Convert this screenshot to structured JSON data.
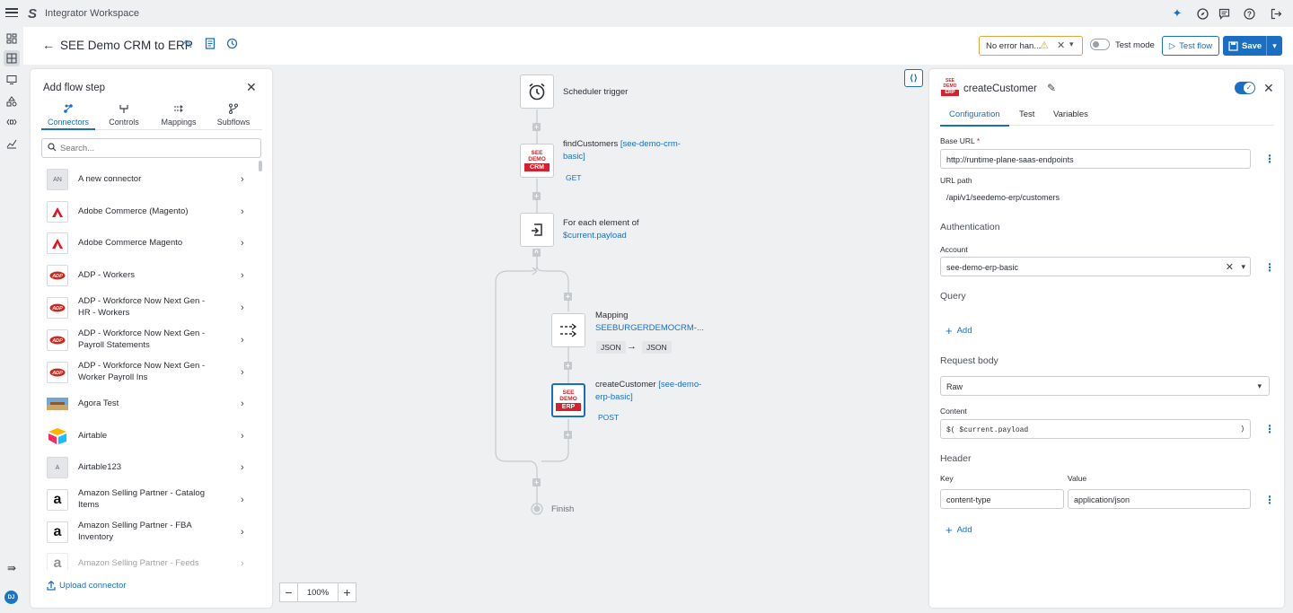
{
  "app": {
    "title": "Integrator Workspace"
  },
  "topbar_icons": [
    "sparkle-icon",
    "compass-icon",
    "chat-icon",
    "help-icon",
    "logout-icon"
  ],
  "rail": {
    "avatar_initials": "DJ"
  },
  "header": {
    "flow_title": "SEE Demo CRM to ERP",
    "error_handling": "No error han...",
    "test_mode_label": "Test mode",
    "test_flow_label": "Test flow",
    "save_label": "Save"
  },
  "add_step": {
    "title": "Add flow step",
    "tabs": [
      {
        "label": "Connectors",
        "icon": "connectors-icon"
      },
      {
        "label": "Controls",
        "icon": "controls-icon"
      },
      {
        "label": "Mappings",
        "icon": "mappings-icon"
      },
      {
        "label": "Subflows",
        "icon": "subflows-icon"
      }
    ],
    "search_placeholder": "Search...",
    "items": [
      {
        "label": "A new connector",
        "logo": "AN"
      },
      {
        "label": "Adobe Commerce (Magento)",
        "logo": "adobe"
      },
      {
        "label": "Adobe Commerce Magento",
        "logo": "adobe"
      },
      {
        "label": "ADP - Workers",
        "logo": "adp"
      },
      {
        "label": "ADP - Workforce Now Next Gen - HR - Workers",
        "logo": "adp"
      },
      {
        "label": "ADP - Workforce Now Next Gen - Payroll Statements",
        "logo": "adp"
      },
      {
        "label": "ADP - Workforce Now Next Gen - Worker Payroll Ins",
        "logo": "adp"
      },
      {
        "label": "Agora Test",
        "logo": "agora"
      },
      {
        "label": "Airtable",
        "logo": "airtable"
      },
      {
        "label": "Airtable123",
        "logo": "A"
      },
      {
        "label": "Amazon Selling Partner - Catalog Items",
        "logo": "a"
      },
      {
        "label": "Amazon Selling Partner - FBA Inventory",
        "logo": "a"
      },
      {
        "label": "Amazon Selling Partner - Feeds",
        "logo": "a"
      }
    ],
    "upload_label": "Upload connector"
  },
  "canvas": {
    "zoom": "100%",
    "nodes": {
      "trigger": {
        "label": "Scheduler trigger"
      },
      "find": {
        "label": "findCustomers ",
        "conn": "[see-demo-crm-basic]",
        "method": "GET",
        "logo_top": "SEE\nDEMO",
        "logo_box": "CRM"
      },
      "foreach": {
        "label": "For each element of",
        "expr": "$current.payload"
      },
      "mapping": {
        "label": "Mapping",
        "name": "SEEBURGERDEMOCRM-...",
        "from": "JSON",
        "to": "JSON"
      },
      "create": {
        "label": "createCustomer ",
        "conn": "[see-demo-erp-basic]",
        "method": "POST",
        "logo_box": "ERP"
      },
      "finish": {
        "label": "Finish"
      }
    }
  },
  "config": {
    "title": "createCustomer",
    "tabs": [
      "Configuration",
      "Test",
      "Variables"
    ],
    "base_url_label": "Base URL",
    "base_url": "http://runtime-plane-saas-endpoints",
    "url_path_label": "URL path",
    "url_path": "/api/v1/seedemo-erp/customers",
    "authentication": "Authentication",
    "account_label": "Account",
    "account": "see-demo-erp-basic",
    "query": "Query",
    "add": "Add",
    "request_body": "Request body",
    "body_type": "Raw",
    "content_label": "Content",
    "content": "$( $current.payload",
    "content_close": ")",
    "header": "Header",
    "key_label": "Key",
    "value_label": "Value",
    "header_key": "content-type",
    "header_value": "application/json"
  },
  "colors": {
    "accent": "#1b6fc2",
    "warning": "#e5a13c",
    "brand_red": "#d3212d"
  }
}
